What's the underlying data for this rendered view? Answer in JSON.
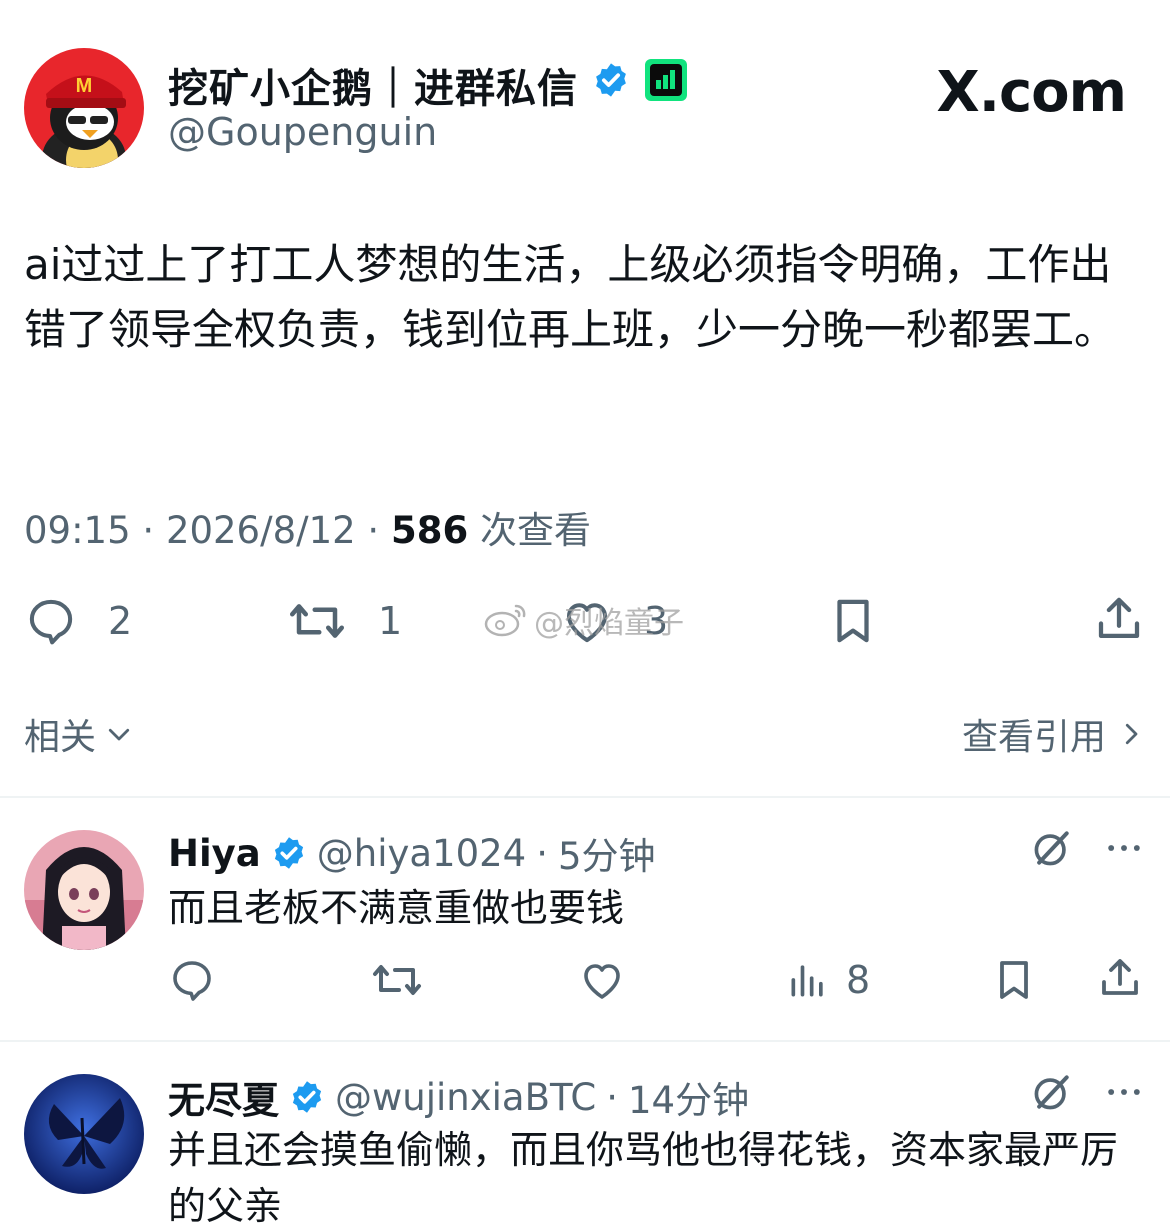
{
  "brand": {
    "site_logo": "X.com"
  },
  "tweet": {
    "author_name": "挖矿小企鹅｜进群私信",
    "author_handle": "@Goupenguin",
    "text": "ai过过上了打工人梦想的生活，上级必须指令明确，工作出错了领导全权负责，钱到位再上班，少一分晚一秒都罢工。",
    "time": "09:15",
    "date": "2026/8/12",
    "views": "586",
    "views_label": "次查看",
    "replies": "2",
    "retweets": "1",
    "likes": "3"
  },
  "watermark": {
    "text": "@烈焰童子"
  },
  "related": {
    "label": "相关"
  },
  "quotes": {
    "label": "查看引用"
  },
  "replies": [
    {
      "name": "Hiya",
      "handle": "@hiya1024",
      "time": "5分钟",
      "text": "而且老板不满意重做也要钱",
      "views": "8"
    },
    {
      "name": "无尽夏",
      "handle": "@wujinxiaBTC",
      "time": "14分钟",
      "text": "并且还会摸鱼偷懒，而且你骂他也得花钱，资本家最严厉的父亲"
    }
  ],
  "colors": {
    "verified": "#1d9bf0",
    "secondary_text": "#536471",
    "primary_text": "#0f1419",
    "divider": "#eff3f4"
  }
}
